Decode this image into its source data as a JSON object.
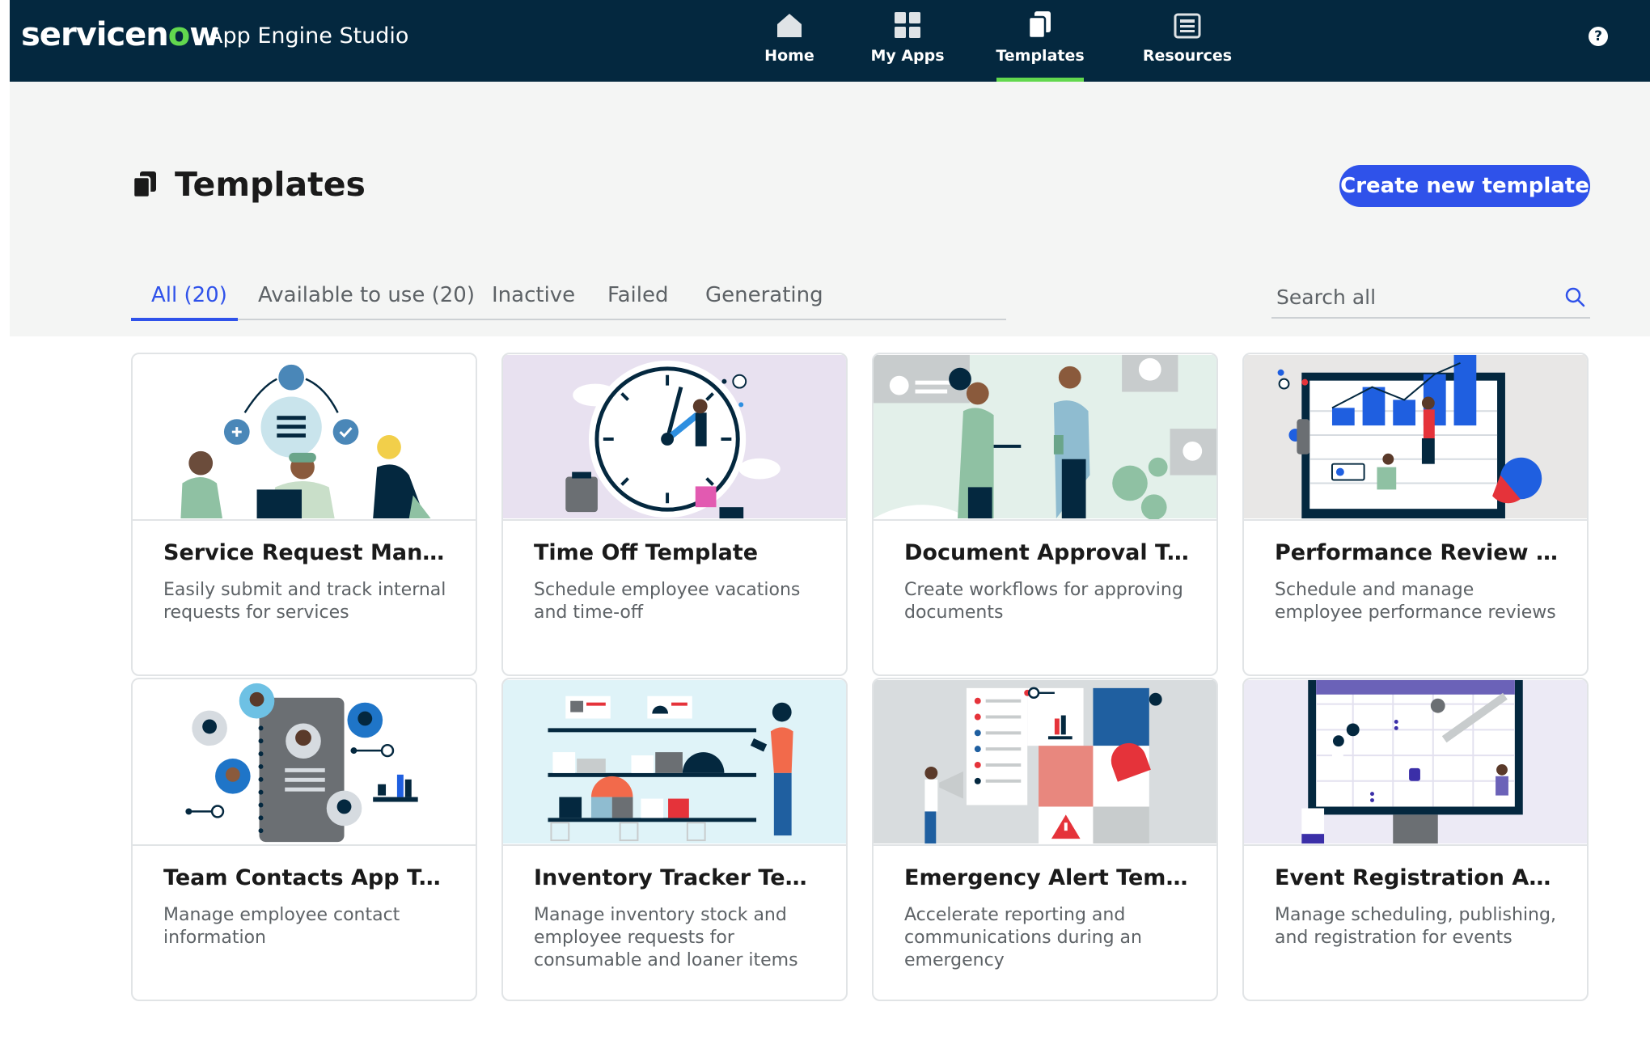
{
  "header": {
    "logo_text_1": "servicen",
    "logo_text_accent": "o",
    "logo_text_2": "w",
    "app_name": "App Engine Studio",
    "nav": [
      {
        "label": "Home",
        "icon": "home-icon"
      },
      {
        "label": "My Apps",
        "icon": "grid-icon"
      },
      {
        "label": "Templates",
        "icon": "templates-icon",
        "active": true
      },
      {
        "label": "Resources",
        "icon": "resources-icon"
      }
    ],
    "help_label": "?"
  },
  "page": {
    "title": "Templates",
    "create_button": "Create new template"
  },
  "tabs": [
    {
      "label": "All (20)",
      "active": true
    },
    {
      "label": "Available to use (20)"
    },
    {
      "label": "Inactive"
    },
    {
      "label": "Failed"
    },
    {
      "label": "Generating"
    }
  ],
  "search": {
    "placeholder": "Search all"
  },
  "templates": [
    {
      "title": "Service Request Managem...",
      "description": "Easily submit and track internal requests for services"
    },
    {
      "title": "Time Off Template",
      "description": "Schedule employee vacations and time-off"
    },
    {
      "title": "Document Approval Temp...",
      "description": "Create workflows for approving documents"
    },
    {
      "title": "Performance Review Tem...",
      "description": "Schedule and manage employee performance reviews"
    },
    {
      "title": "Team Contacts App Templ...",
      "description": "Manage employee contact information"
    },
    {
      "title": "Inventory Tracker Template",
      "description": "Manage inventory stock and employee requests for consumable and loaner items"
    },
    {
      "title": "Emergency Alert Template",
      "description": "Accelerate reporting and communications during an emergency"
    },
    {
      "title": "Event Registration App Te...",
      "description": "Manage scheduling, publishing, and registration for events"
    }
  ],
  "colors": {
    "header_bg": "#04283f",
    "accent_green": "#62d84e",
    "primary_blue": "#2f52ea"
  }
}
